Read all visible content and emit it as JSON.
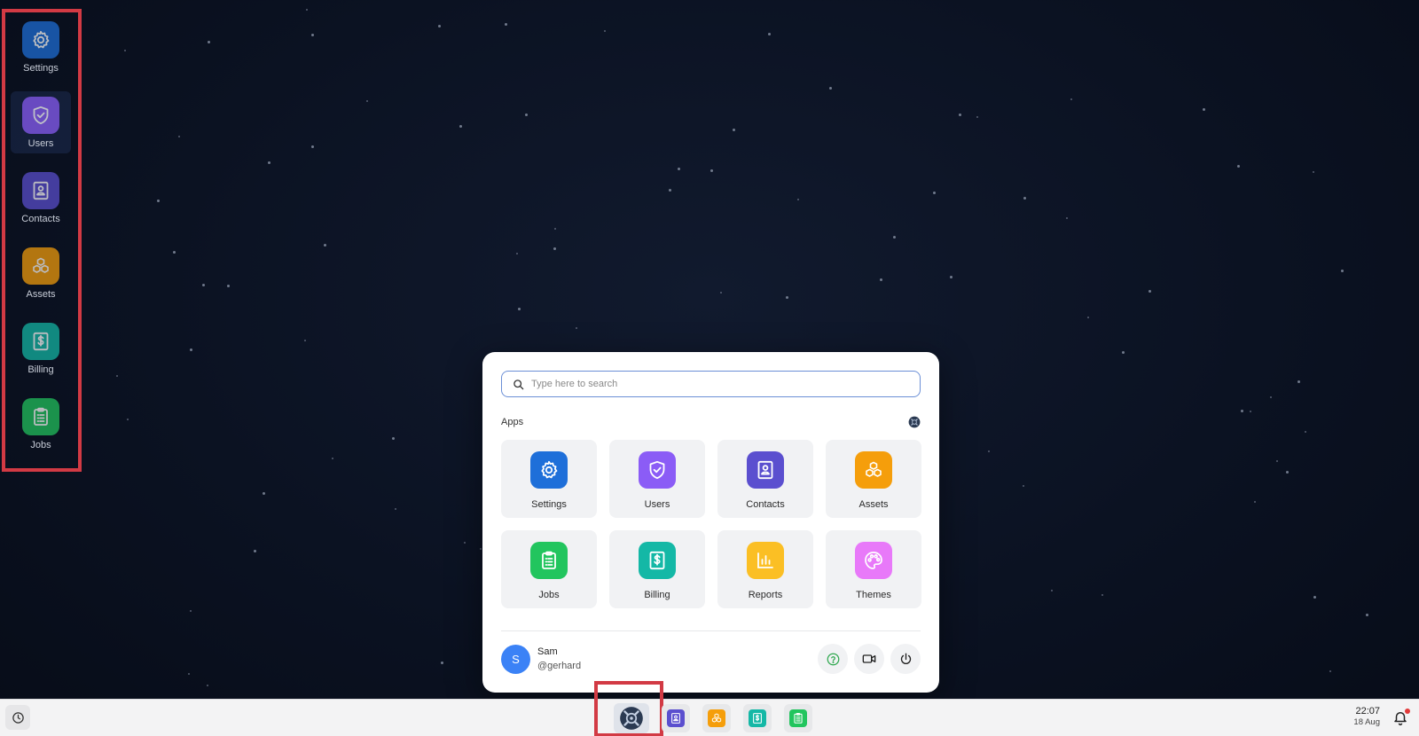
{
  "desktop": {
    "icons": [
      {
        "label": "Settings",
        "icon": "gear-icon",
        "color": "#1e6fd9"
      },
      {
        "label": "Users",
        "icon": "shield-check-icon",
        "color": "#8b5cf6"
      },
      {
        "label": "Contacts",
        "icon": "contact-card-icon",
        "color": "#5b4fcf"
      },
      {
        "label": "Assets",
        "icon": "cubes-icon",
        "color": "#f59e0b"
      },
      {
        "label": "Billing",
        "icon": "invoice-dollar-icon",
        "color": "#14b8a6"
      },
      {
        "label": "Jobs",
        "icon": "clipboard-list-icon",
        "color": "#22c55e"
      }
    ]
  },
  "start_menu": {
    "search": {
      "placeholder": "Type here to search",
      "value": ""
    },
    "section_title": "Apps",
    "apps": [
      {
        "label": "Settings",
        "icon": "gear-icon",
        "color": "#1e6fd9"
      },
      {
        "label": "Users",
        "icon": "shield-check-icon",
        "color": "#8b5cf6"
      },
      {
        "label": "Contacts",
        "icon": "contact-card-icon",
        "color": "#5b4fcf"
      },
      {
        "label": "Assets",
        "icon": "cubes-icon",
        "color": "#f59e0b"
      },
      {
        "label": "Jobs",
        "icon": "clipboard-list-icon",
        "color": "#22c55e"
      },
      {
        "label": "Billing",
        "icon": "invoice-dollar-icon",
        "color": "#14b8a6"
      },
      {
        "label": "Reports",
        "icon": "bar-chart-icon",
        "color": "#fbbf24"
      },
      {
        "label": "Themes",
        "icon": "palette-icon",
        "color": "#e879f9"
      }
    ],
    "user": {
      "initial": "S",
      "name": "Sam",
      "handle": "@gerhard",
      "avatar_color": "#3b82f6"
    },
    "actions": [
      {
        "icon": "help-circle-icon"
      },
      {
        "icon": "video-camera-icon"
      },
      {
        "icon": "power-icon"
      }
    ]
  },
  "taskbar": {
    "left_icon": "clock-icon",
    "apps": [
      {
        "icon": "contact-card-icon",
        "color": "#5b4fcf"
      },
      {
        "icon": "cubes-icon",
        "color": "#f59e0b"
      },
      {
        "icon": "invoice-dollar-icon",
        "color": "#14b8a6"
      },
      {
        "icon": "clipboard-list-icon",
        "color": "#22c55e"
      }
    ],
    "time": "22:07",
    "date": "18 Aug",
    "accent_color": "#d23a44"
  }
}
